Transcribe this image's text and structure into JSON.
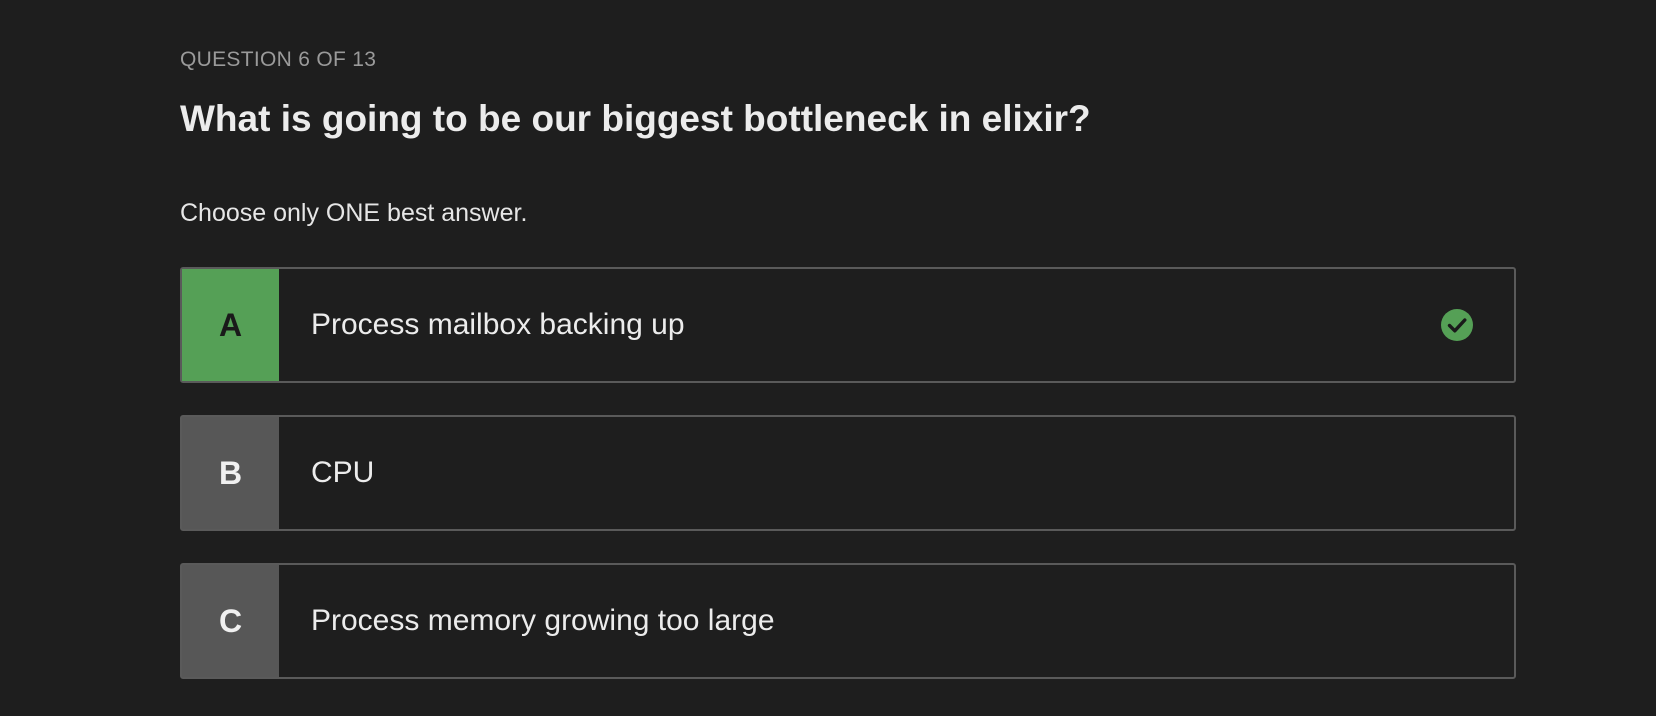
{
  "quiz": {
    "counter": "QUESTION 6 OF 13",
    "question": "What is going to be our biggest bottleneck in elixir?",
    "instruction": "Choose only ONE best answer.",
    "accent_color": "#55a056",
    "options": [
      {
        "letter": "A",
        "text": "Process mailbox backing up",
        "selected": true,
        "icon": "check-circle-icon"
      },
      {
        "letter": "B",
        "text": "CPU",
        "selected": false
      },
      {
        "letter": "C",
        "text": "Process memory growing too large",
        "selected": false
      }
    ]
  }
}
